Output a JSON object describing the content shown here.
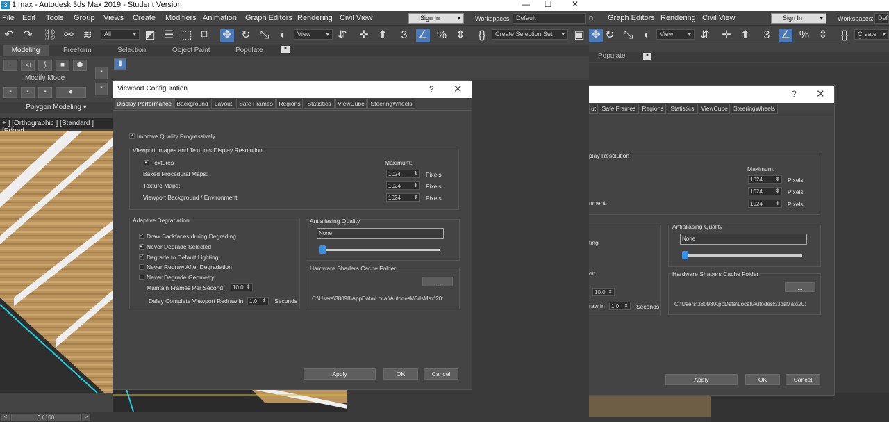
{
  "window": {
    "title": "1.max - Autodesk 3ds Max 2019 - Student Version",
    "icon": "3",
    "minimize": "—",
    "maximize": "☐",
    "close": "✕"
  },
  "menu": [
    "File",
    "Edit",
    "Tools",
    "Group",
    "Views",
    "Create",
    "Modifiers",
    "Animation",
    "Graph Editors",
    "Rendering",
    "Civil View"
  ],
  "menu2": [
    "Graph Editors",
    "Rendering",
    "Civil View"
  ],
  "sign_in": "Sign In",
  "workspaces_label": "Workspaces:",
  "workspaces_value": "Default",
  "workspaces_value2": "Defa",
  "toolbar": {
    "filter": "All",
    "view": "View",
    "create_selection_set": "Create Selection Set",
    "create_selection_set2": "Create Sele"
  },
  "ribbon": {
    "tabs": [
      "Modeling",
      "Freeform",
      "Selection",
      "Object Paint",
      "Populate"
    ],
    "tab2": "Populate",
    "modify_mode": "Modify Mode",
    "polygon_modeling": "Polygon Modeling"
  },
  "viewport_label": "+ ] [Orthographic ] [Standard ] [Edged",
  "timeline": "0 / 100",
  "dialog": {
    "title": "Viewport Configuration",
    "help": "?",
    "close": "✕",
    "tabs": [
      "Display Performance",
      "Background",
      "Layout",
      "Safe Frames",
      "Regions",
      "Statistics",
      "ViewCube",
      "SteeringWheels"
    ],
    "improve_quality": "Improve Quality Progressively",
    "images_group": "Viewport Images and Textures Display Resolution",
    "textures": "Textures",
    "maximum": "Maximum:",
    "baked_maps": "Baked Procedural Maps:",
    "texture_maps": "Texture Maps:",
    "viewport_bg": "Viewport Background / Environment:",
    "res1": "1024",
    "res2": "1024",
    "res3": "1024",
    "pixels": "Pixels",
    "adaptive_group": "Adaptive Degradation",
    "draw_backfaces": "Draw Backfaces during Degrading",
    "never_degrade_selected": "Never Degrade Selected",
    "degrade_default_lighting": "Degrade to Default Lighting",
    "never_redraw": "Never Redraw After Degradation",
    "never_degrade_geometry": "Never Degrade Geometry",
    "maintain_fps": "Maintain Frames Per Second:",
    "fps_value": "10.0",
    "delay_redraw": "Delay Complete Viewport Redraw in",
    "delay_value": "1.0",
    "seconds": "Seconds",
    "aa_group": "Antialiasing Quality",
    "aa_value": "None",
    "cache_group": "Hardware Shaders Cache Folder",
    "browse": "...",
    "cache_path": "C:\\Users\\38098\\AppData\\Local\\Autodesk\\3dsMax\\20:",
    "apply": "Apply",
    "ok": "OK",
    "cancel": "Cancel",
    "checkmark": "✔"
  },
  "dialog2": {
    "tab_partial": "ut",
    "tabs": [
      "Safe Frames",
      "Regions",
      "Statistics",
      "ViewCube",
      "SteeringWheels"
    ],
    "images_partial": "play Resolution",
    "lighting_partial": "ting",
    "on_partial": "on",
    "env_partial": "nment:",
    "redraw_partial": "raw in",
    "maximum": "Maximum:",
    "res": [
      "1024",
      "1024",
      "1024"
    ],
    "pixels": "Pixels",
    "fps_value": "10.0",
    "delay_value": "1.0",
    "seconds": "Seconds",
    "aa_group": "Antialiasing Quality",
    "aa_value": "None",
    "cache_group": "Hardware Shaders Cache Folder",
    "browse": "...",
    "cache_path": "C:\\Users\\38098\\AppData\\Local\\Autodesk\\3dsMax\\20:",
    "apply": "Apply",
    "ok": "OK",
    "cancel": "Cancel",
    "help": "?",
    "close": "✕"
  },
  "accent": "#3a8fe0"
}
